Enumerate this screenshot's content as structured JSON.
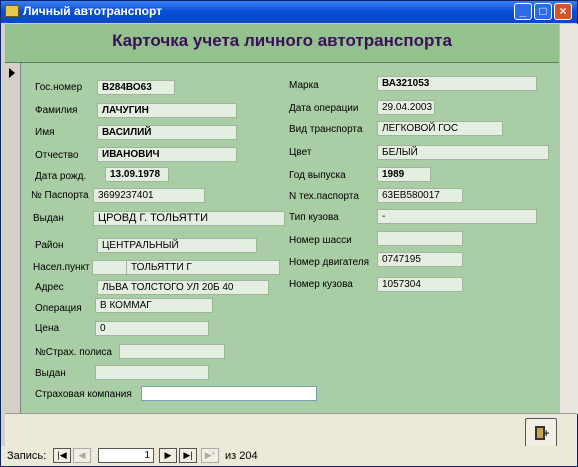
{
  "window": {
    "title": "Личный автотранспорт"
  },
  "form": {
    "title": "Карточка учета личного автотранспорта"
  },
  "left": {
    "gos_nomer": {
      "label": "Гос.номер",
      "value": "В284ВО63"
    },
    "familiya": {
      "label": "Фамилия",
      "value": "ЛАЧУГИН"
    },
    "imya": {
      "label": "Имя",
      "value": "ВАСИЛИЙ"
    },
    "otchestvo": {
      "label": "Отчество",
      "value": "ИВАНОВИЧ"
    },
    "data_rozhd": {
      "label": "Дата рожд.",
      "value": "13.09.1978"
    },
    "pasport": {
      "label": "№ Паспорта",
      "value": "3699237401"
    },
    "vydan": {
      "label": "Выдан",
      "value": "ЦРОВД Г. ТОЛЬЯТТИ"
    },
    "rayon": {
      "label": "Район",
      "value": "ЦЕНТРАЛЬНЫЙ"
    },
    "nasel_punkt": {
      "label": "Насел.пункт",
      "value1": "",
      "value2": "ТОЛЬЯТТИ Г"
    },
    "adres": {
      "label": "Адрес",
      "value": "ЛЬВА ТОЛСТОГО УЛ 20Б 40"
    },
    "operaciya": {
      "label": "Операция",
      "value": "В КОММАГ"
    },
    "cena": {
      "label": "Цена",
      "value": "0"
    },
    "strah_polis": {
      "label": "№Страх. полиса",
      "value": ""
    },
    "vydan2": {
      "label": "Выдан",
      "value": ""
    },
    "strah_komp": {
      "label": "Страховая компания",
      "value": ""
    }
  },
  "right": {
    "marka": {
      "label": "Марка",
      "value": "ВА321053"
    },
    "data_operacii": {
      "label": "Дата операции",
      "value": "29.04.2003"
    },
    "vid_transporta": {
      "label": "Вид транспорта",
      "value": "ЛЕГКОВОЙ ГОС"
    },
    "cvet": {
      "label": "Цвет",
      "value": "БЕЛЫЙ"
    },
    "god_vypuska": {
      "label": "Год выпуска",
      "value": "1989"
    },
    "n_teh_pasporta": {
      "label": "N тех.паспорта",
      "value": "63ЕВ580017"
    },
    "tip_kuzova": {
      "label": "Тип кузова",
      "value": "-"
    },
    "nomer_shassi": {
      "label": "Номер шасси",
      "value": ""
    },
    "nomer_dvigatelya": {
      "label": "Номер двигателя",
      "value": "0747195"
    },
    "nomer_kuzova": {
      "label": "Номер кузова",
      "value": "1057304"
    }
  },
  "nav": {
    "label": "Запись:",
    "current": "1",
    "of_label": "из",
    "total": "204",
    "first": "|◀",
    "prev": "◀",
    "next": "▶",
    "last": "▶|",
    "new": "▶*"
  },
  "icons": {
    "exit": "exit-door-icon",
    "record_selector": "record-selector-arrow-icon"
  }
}
